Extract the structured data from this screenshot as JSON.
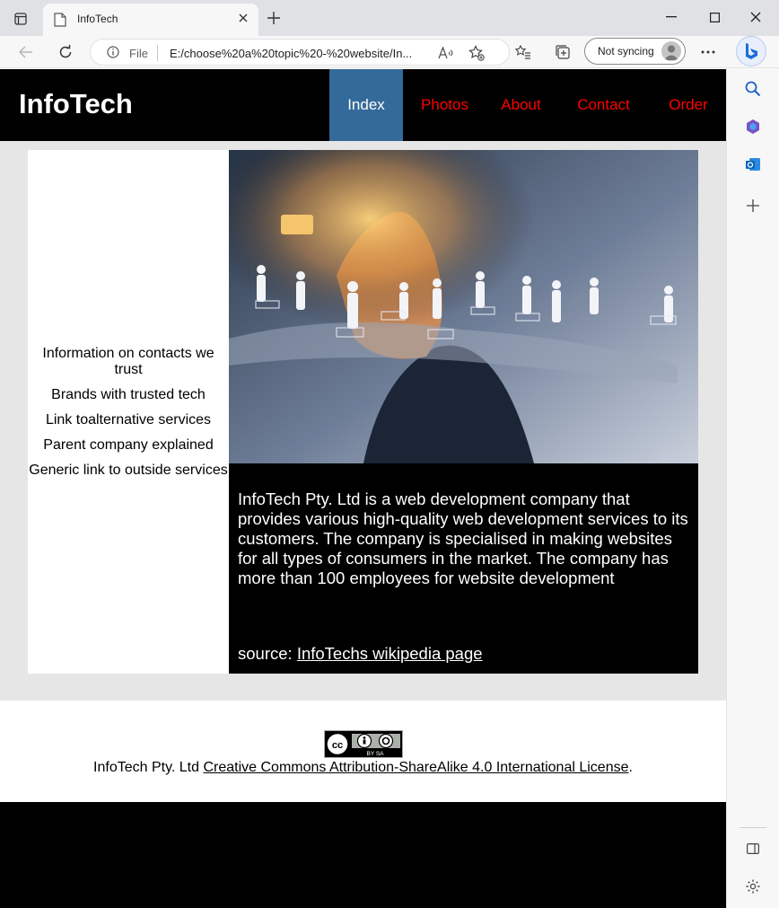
{
  "browser": {
    "tab_title": "InfoTech",
    "address_prefix": "File",
    "url": "E:/choose%20a%20topic%20-%20website/In...",
    "sync_label": "Not syncing"
  },
  "site": {
    "logo": "InfoTech",
    "nav": [
      {
        "label": "Index"
      },
      {
        "label": "Photos"
      },
      {
        "label": "About"
      },
      {
        "label": "Contact"
      },
      {
        "label": "Order"
      }
    ],
    "sidebar_links": [
      {
        "label": "Information on contacts we trust"
      },
      {
        "label": "Brands with trusted tech"
      },
      {
        "label": "Link toalternative services"
      },
      {
        "label": "Parent company explained"
      },
      {
        "label": "Generic link to outside services"
      }
    ],
    "info_text": "InfoTech Pty. Ltd is a web development company that provides various high-quality web development services to its customers. The company is specialised in making websites for all types of consumers in the market. The company has more than 100 employees for website development",
    "source_prefix": "source: ",
    "source_link": "InfoTechs wikipedia page",
    "footer_prefix": "InfoTech Pty. Ltd ",
    "footer_link": "Creative Commons Attribution-ShareAlike 4.0 International License",
    "footer_suffix": ".",
    "cc_badge_text": "BY  SA"
  },
  "colors": {
    "header_bg": "#000000",
    "nav_link": "#ff0000",
    "nav_active_bg": "#336a99",
    "page_bg": "#e6e6e6"
  }
}
